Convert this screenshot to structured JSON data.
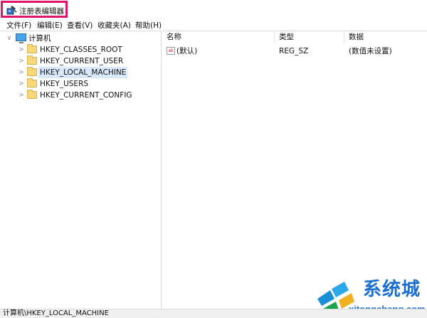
{
  "window": {
    "title": "注册表编辑器",
    "title_icon": "regedit-icon"
  },
  "menu": [
    {
      "label": "文件(F)"
    },
    {
      "label": "编辑(E)"
    },
    {
      "label": "查看(V)"
    },
    {
      "label": "收藏夹(A)"
    },
    {
      "label": "帮助(H)"
    }
  ],
  "tree": {
    "root": {
      "label": "计算机",
      "icon": "computer-icon"
    },
    "items": [
      {
        "label": "HKEY_CLASSES_ROOT"
      },
      {
        "label": "HKEY_CURRENT_USER"
      },
      {
        "label": "HKEY_LOCAL_MACHINE",
        "selected": true
      },
      {
        "label": "HKEY_USERS"
      },
      {
        "label": "HKEY_CURRENT_CONFIG"
      }
    ]
  },
  "list": {
    "columns": [
      "名称",
      "类型",
      "数据"
    ],
    "rows": [
      {
        "name": "(默认)",
        "type": "REG_SZ",
        "data": "(数值未设置)"
      }
    ]
  },
  "status": {
    "path": "计算机\\HKEY_LOCAL_MACHINE"
  },
  "watermark": {
    "text": "系统城",
    "sub": "xitongcheng.com"
  },
  "colors": {
    "highlight_border": "#e0146b",
    "selection": "#d9e8fb",
    "folder": "#f6d77a"
  }
}
